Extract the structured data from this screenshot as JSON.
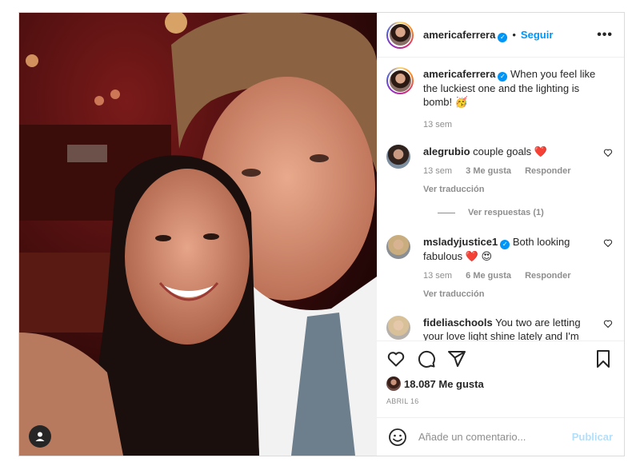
{
  "post": {
    "username": "americaferrera",
    "follow_label": "Seguir",
    "more_label": "•••"
  },
  "caption": {
    "username": "americaferrera",
    "text": "When you feel like the luckiest one and the lighting is bomb! 🥳",
    "time": "13 sem"
  },
  "comments": [
    {
      "username": "alegrubio",
      "text": "couple goals ❤️",
      "time": "13 sem",
      "likes": "3 Me gusta",
      "reply_label": "Responder",
      "translate_label": "Ver traducción"
    },
    {
      "username": "msladyjustice1",
      "text": "Both looking fabulous ❤️ 😍",
      "time": "13 sem",
      "likes": "6 Me gusta",
      "reply_label": "Responder",
      "translate_label": "Ver traducción"
    },
    {
      "username": "fideliaschools",
      "text": "You two are letting your love light shine lately and I'm HERE for it!! 🔥♥"
    }
  ],
  "view_replies_label": "Ver respuestas (1)",
  "likes_count": "18.087 Me gusta",
  "post_date": "ABRIL 16",
  "comment_input": {
    "placeholder": "Añade un comentario..."
  },
  "publish_label": "Publicar",
  "icons": {
    "like": "heart-outline-icon",
    "comment": "comment-icon",
    "share": "send-icon",
    "save": "bookmark-icon",
    "emoji": "emoji-icon",
    "tag": "user-tag-icon",
    "verified": "verified-badge-icon"
  },
  "colors": {
    "accent": "#0095f6",
    "publish_disabled": "#b2dffc",
    "muted": "#8e8e8e",
    "heart": "#ed4956"
  }
}
